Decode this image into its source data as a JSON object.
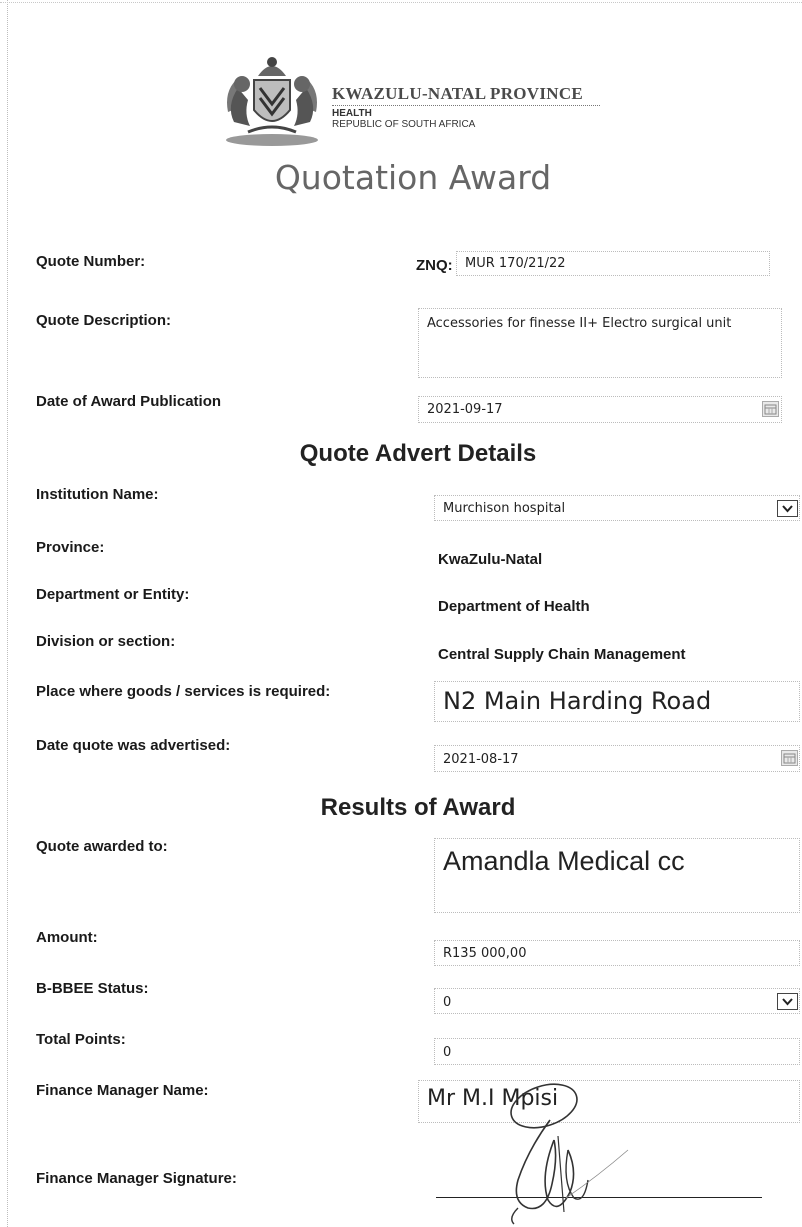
{
  "header": {
    "org_name": "KWAZULU-NATAL PROVINCE",
    "dept": "HEALTH",
    "country": "REPUBLIC OF SOUTH AFRICA"
  },
  "title": "Quotation Award",
  "quote": {
    "number_label": "Quote Number:",
    "number_prefix": "ZNQ:",
    "number_value": "MUR 170/21/22",
    "description_label": "Quote Description:",
    "description_value": "Accessories for finesse II+ Electro surgical unit",
    "publication_label": "Date of Award Publication",
    "publication_value": "2021-09-17"
  },
  "advert": {
    "section_title": "Quote Advert Details",
    "institution_label": "Institution Name:",
    "institution_value": "Murchison hospital",
    "province_label": "Province:",
    "province_value": "KwaZulu-Natal",
    "department_label": "Department or Entity:",
    "department_value": "Department of Health",
    "division_label": "Division or section:",
    "division_value": "Central Supply Chain Management",
    "place_label": "Place where goods /  services is required:",
    "place_value": "N2  Main Harding Road",
    "advertised_label": "Date quote was advertised:",
    "advertised_value": "2021-08-17"
  },
  "results": {
    "section_title": "Results of Award",
    "awarded_label": "Quote awarded to:",
    "awarded_value": "Amandla Medical cc",
    "amount_label": "Amount:",
    "amount_value": "R135 000,00",
    "bbbee_label": "B-BBEE Status:",
    "bbbee_value": "0",
    "points_label": "Total Points:",
    "points_value": "0",
    "manager_label": "Finance Manager Name:",
    "manager_value": "Mr M.I Mpisi",
    "signature_label": "Finance Manager Signature:"
  }
}
